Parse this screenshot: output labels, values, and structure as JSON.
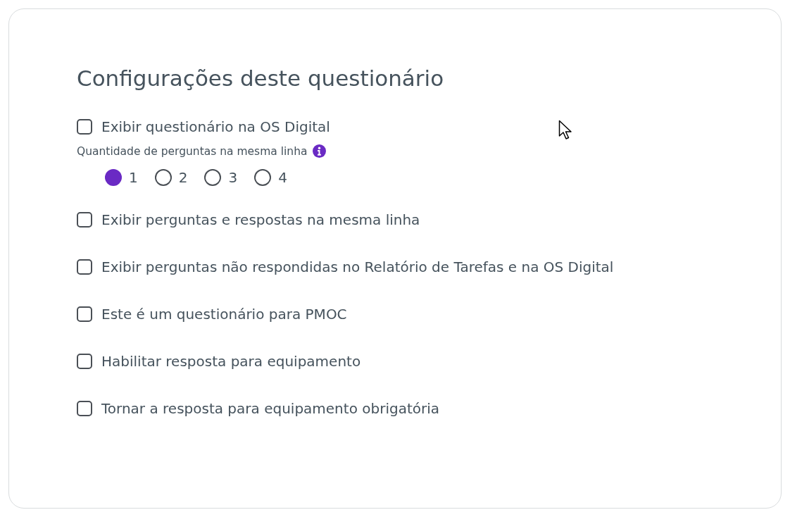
{
  "title": "Configurações deste questionário",
  "settings": [
    {
      "kind": "checkbox",
      "label": "Exibir questionário na OS Digital",
      "checked": false
    },
    {
      "kind": "radio_group",
      "label": "Quantidade de perguntas na mesma linha",
      "options": [
        {
          "label": "1",
          "selected": true
        },
        {
          "label": "2",
          "selected": false
        },
        {
          "label": "3",
          "selected": false
        },
        {
          "label": "4",
          "selected": false
        }
      ]
    },
    {
      "kind": "checkbox",
      "label": "Exibir perguntas e respostas na mesma linha",
      "checked": false
    },
    {
      "kind": "checkbox",
      "label": "Exibir perguntas não respondidas no Relatório de Tarefas e na OS Digital",
      "checked": false
    },
    {
      "kind": "checkbox",
      "label": "Este é um questionário para PMOC",
      "checked": false
    },
    {
      "kind": "checkbox",
      "label": "Habilitar resposta para equipamento",
      "checked": false
    },
    {
      "kind": "checkbox",
      "label": "Tornar a resposta para equipamento obrigatória",
      "checked": false
    }
  ]
}
